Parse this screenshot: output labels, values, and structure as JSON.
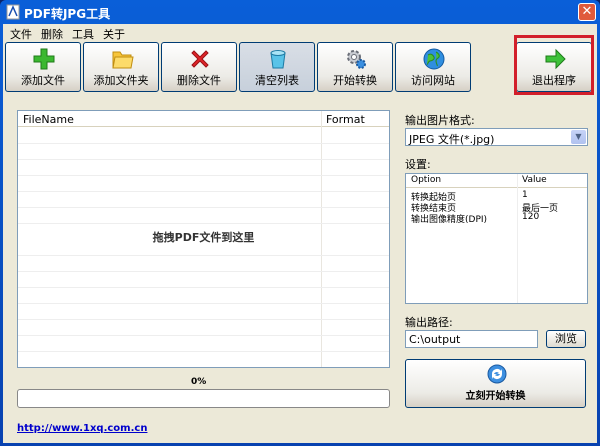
{
  "window": {
    "title": "PDF转JPG工具",
    "close_glyph": "✕"
  },
  "menu": [
    "文件",
    "删除",
    "工具",
    "关于"
  ],
  "toolbar": [
    {
      "label": "添加文件",
      "icon": "add-icon"
    },
    {
      "label": "添加文件夹",
      "icon": "folder-icon"
    },
    {
      "label": "删除文件",
      "icon": "delete-icon"
    },
    {
      "label": "清空列表",
      "icon": "clear-list-icon"
    },
    {
      "label": "开始转换",
      "icon": "gear-icon"
    },
    {
      "label": "访问网站",
      "icon": "globe-icon"
    },
    {
      "label": "退出程序",
      "icon": "exit-arrow-icon"
    }
  ],
  "filelist": {
    "col_filename": "FileName",
    "col_format": "Format",
    "empty_hint": "拖拽PDF文件到这里"
  },
  "progress": {
    "percent_text": "0%",
    "value": 0
  },
  "website": "http://www.1xq.com.cn",
  "format": {
    "label": "输出图片格式:",
    "value": "JPEG 文件(*.jpg)"
  },
  "settings": {
    "label": "设置:",
    "col_option": "Option",
    "col_value": "Value",
    "rows": [
      {
        "option": "转换起始页",
        "value": "1"
      },
      {
        "option": "转换结束页",
        "value": "最后一页"
      },
      {
        "option": "输出图像精度(DPI)",
        "value": "120"
      }
    ]
  },
  "output": {
    "label": "输出路径:",
    "path": "C:\\output",
    "browse": "浏览"
  },
  "start_now": "立刻开始转换",
  "colors": {
    "titlebar": "#0a5fd8",
    "highlight_frame": "#d21f2a",
    "link": "#0000cc"
  }
}
